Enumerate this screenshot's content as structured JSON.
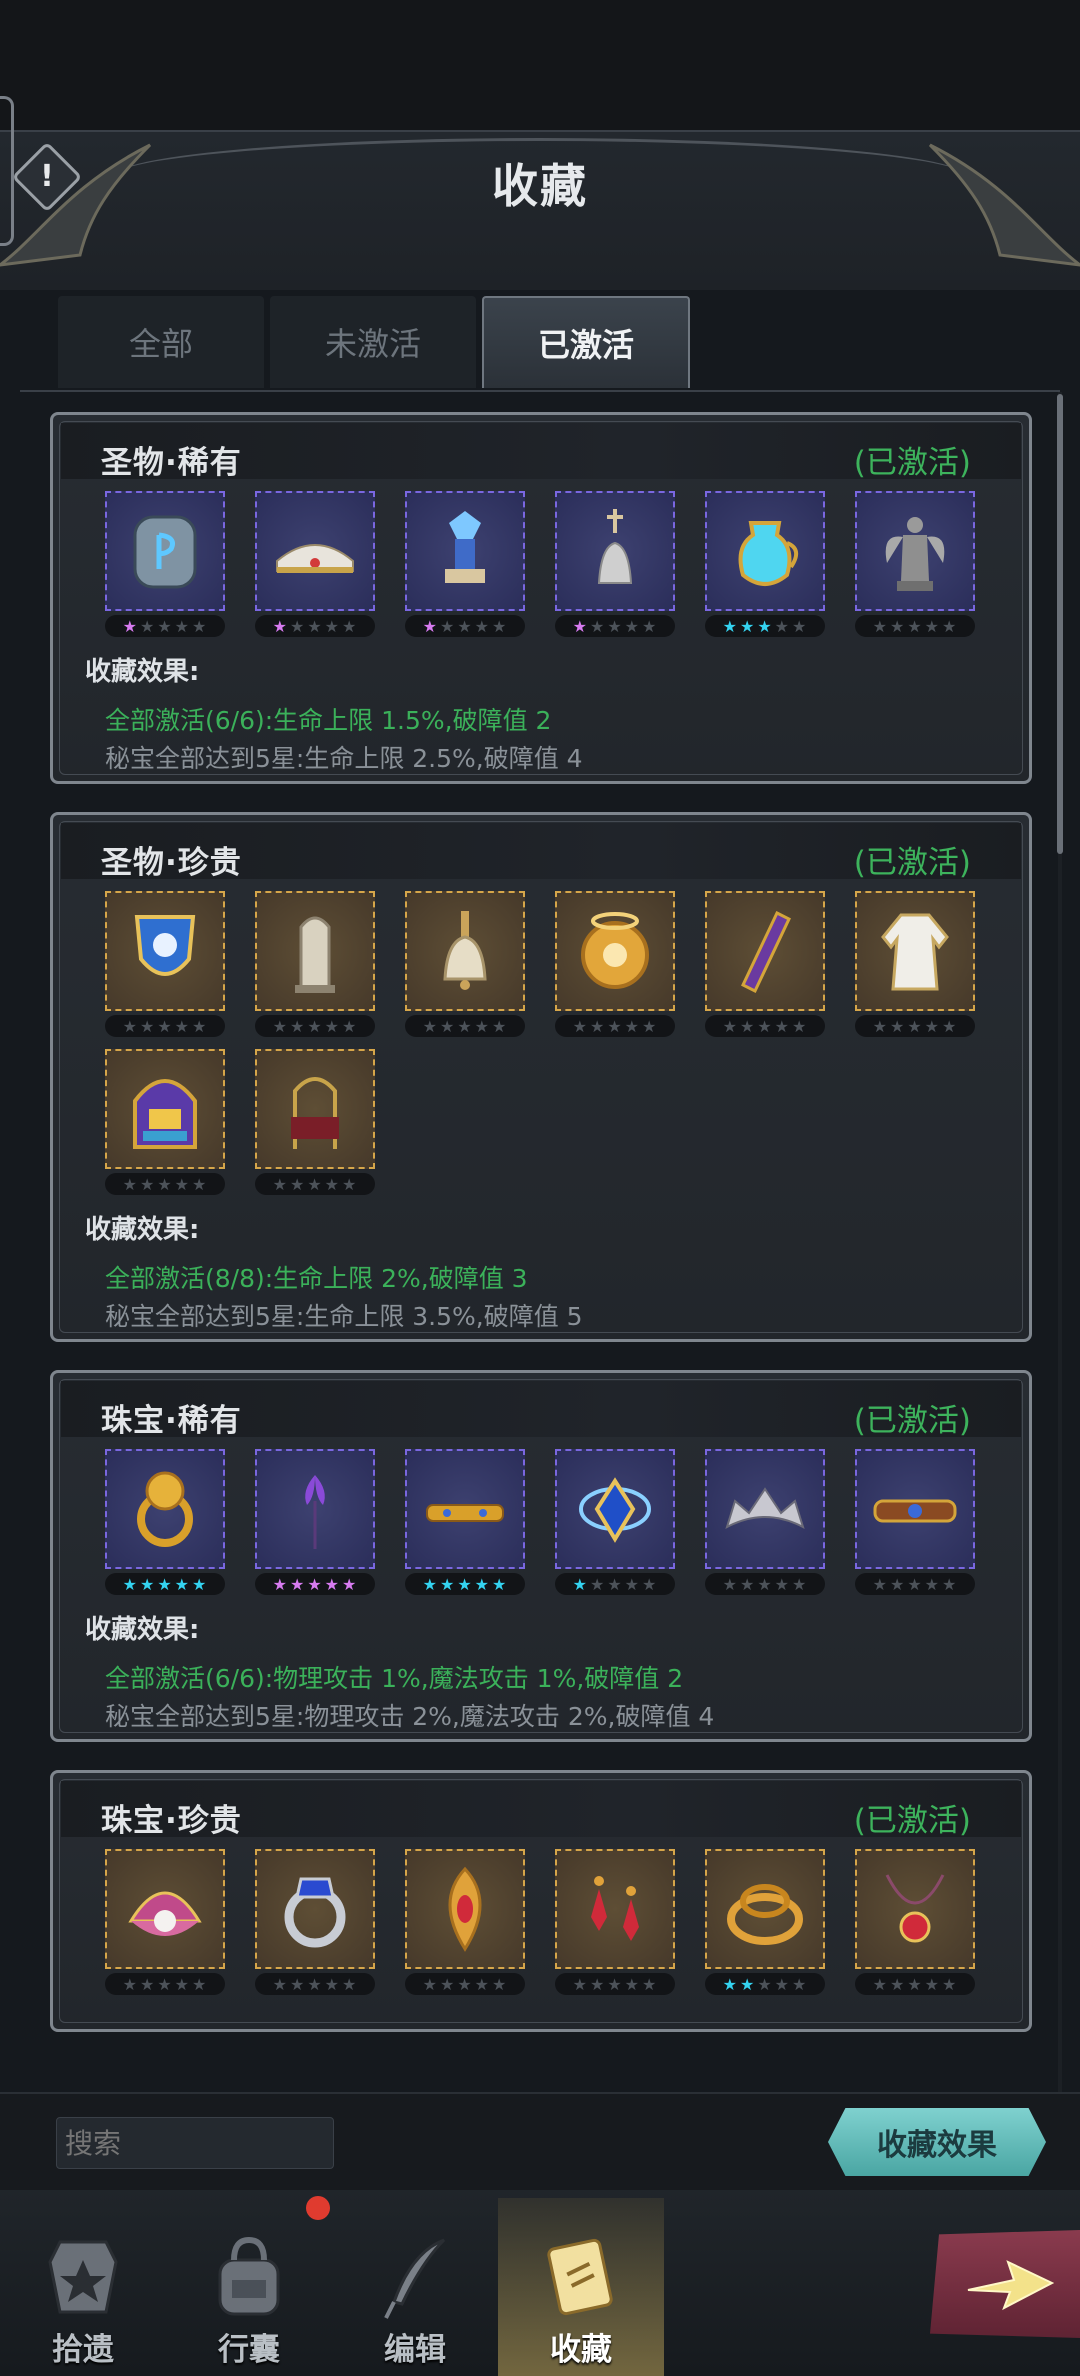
{
  "header": {
    "title": "收藏",
    "info_glyph": "!"
  },
  "tabs": [
    {
      "label": "全部",
      "active": false
    },
    {
      "label": "未激活",
      "active": false
    },
    {
      "label": "已激活",
      "active": true
    }
  ],
  "effect_label": "收藏效果:",
  "groups": [
    {
      "title": "圣物·稀有",
      "status": "(已激活)",
      "rarity": "rare",
      "items": [
        {
          "icon": "rune-stone-icon",
          "stars": 1,
          "star_color": "purple"
        },
        {
          "icon": "white-cap-icon",
          "stars": 1,
          "star_color": "purple"
        },
        {
          "icon": "crystal-trophy-icon",
          "stars": 1,
          "star_color": "purple"
        },
        {
          "icon": "cross-bell-icon",
          "stars": 1,
          "star_color": "purple"
        },
        {
          "icon": "holy-water-jug-icon",
          "stars": 3,
          "star_color": "cyan"
        },
        {
          "icon": "angel-statue-icon",
          "stars": 0,
          "star_color": "none"
        }
      ],
      "effect1": "全部激活(6/6):生命上限 1.5%,破障值 2",
      "effect2": "秘宝全部达到5星:生命上限 2.5%,破障值 4"
    },
    {
      "title": "圣物·珍贵",
      "status": "(已激活)",
      "rarity": "precious",
      "items": [
        {
          "icon": "shield-crest-icon",
          "stars": 0,
          "star_color": "none"
        },
        {
          "icon": "tombstone-icon",
          "stars": 0,
          "star_color": "none"
        },
        {
          "icon": "hand-bell-icon",
          "stars": 0,
          "star_color": "none"
        },
        {
          "icon": "golden-orb-icon",
          "stars": 0,
          "star_color": "none"
        },
        {
          "icon": "purple-stole-icon",
          "stars": 0,
          "star_color": "none"
        },
        {
          "icon": "white-robe-icon",
          "stars": 0,
          "star_color": "none"
        },
        {
          "icon": "stained-glass-icon",
          "stars": 0,
          "star_color": "none"
        },
        {
          "icon": "throne-icon",
          "stars": 0,
          "star_color": "none"
        }
      ],
      "effect1": "全部激活(8/8):生命上限 2%,破障值 3",
      "effect2": "秘宝全部达到5星:生命上限 3.5%,破障值 5"
    },
    {
      "title": "珠宝·稀有",
      "status": "(已激活)",
      "rarity": "rare",
      "items": [
        {
          "icon": "lion-ring-icon",
          "stars": 5,
          "star_color": "cyan"
        },
        {
          "icon": "iris-flower-icon",
          "stars": 5,
          "star_color": "purple"
        },
        {
          "icon": "golden-bracelet-icon",
          "stars": 5,
          "star_color": "cyan"
        },
        {
          "icon": "sapphire-amulet-icon",
          "stars": 1,
          "star_color": "cyan"
        },
        {
          "icon": "tiara-icon",
          "stars": 0,
          "star_color": "none"
        },
        {
          "icon": "jeweled-belt-icon",
          "stars": 0,
          "star_color": "none"
        }
      ],
      "effect1": "全部激活(6/6):物理攻击 1%,魔法攻击 1%,破障值 2",
      "effect2": "秘宝全部达到5星:物理攻击 2%,魔法攻击 2%,破障值 4"
    },
    {
      "title": "珠宝·珍贵",
      "status": "(已激活)",
      "rarity": "precious",
      "items": [
        {
          "icon": "pearl-shell-icon",
          "stars": 0,
          "star_color": "none"
        },
        {
          "icon": "sapphire-ring-icon",
          "stars": 0,
          "star_color": "none"
        },
        {
          "icon": "ruby-brooch-icon",
          "stars": 0,
          "star_color": "none"
        },
        {
          "icon": "ruby-earrings-icon",
          "stars": 0,
          "star_color": "none"
        },
        {
          "icon": "snake-ring-icon",
          "stars": 2,
          "star_color": "cyan"
        },
        {
          "icon": "ruby-necklace-icon",
          "stars": 0,
          "star_color": "none"
        }
      ],
      "effect1": "",
      "effect2": ""
    }
  ],
  "bottom": {
    "search_placeholder": "搜索",
    "effect_button": "收藏效果"
  },
  "nav": [
    {
      "label": "拾遗",
      "icon": "pickup-icon",
      "active": false
    },
    {
      "label": "行囊",
      "icon": "backpack-icon",
      "active": false
    },
    {
      "label": "编辑",
      "icon": "quill-icon",
      "active": false
    },
    {
      "label": "收藏",
      "icon": "collection-scroll-icon",
      "active": true
    }
  ],
  "colors": {
    "active_green": "#3db35c",
    "rare_border": "#7a67e0",
    "precious_border": "#d6a64a",
    "star_purple": "#d77bf0",
    "star_cyan": "#34d3f0"
  }
}
